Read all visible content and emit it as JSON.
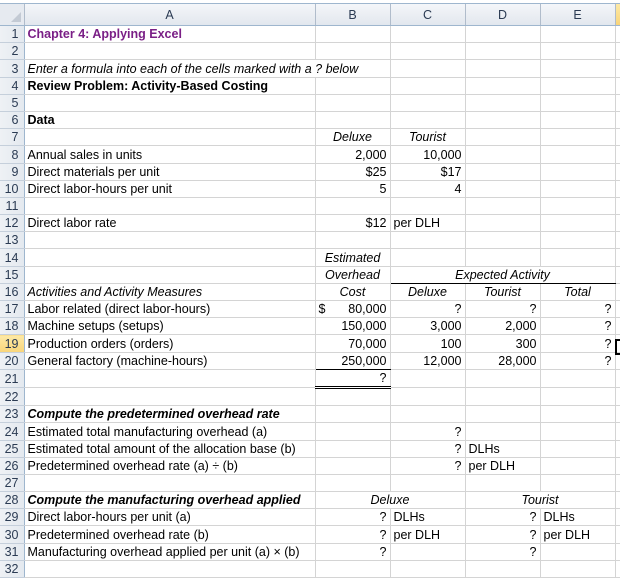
{
  "columns": [
    "A",
    "B",
    "C",
    "D",
    "E"
  ],
  "selected_cell": "F19",
  "rows": {
    "r1": {
      "A": "Chapter 4: Applying Excel"
    },
    "r3": {
      "A": "Enter a formula into each of the cells marked with a ? below"
    },
    "r4": {
      "A": "Review Problem: Activity-Based Costing"
    },
    "r6": {
      "A": "Data"
    },
    "r7": {
      "B": "Deluxe",
      "C": "Tourist"
    },
    "r8": {
      "A": "Annual sales in units",
      "B": "2,000",
      "C": "10,000"
    },
    "r9": {
      "A": "Direct materials per unit",
      "B": "$25",
      "C": "$17"
    },
    "r10": {
      "A": "Direct labor-hours per unit",
      "B": "5",
      "C": "4"
    },
    "r12": {
      "A": "Direct labor rate",
      "B": "$12",
      "C": "per DLH"
    },
    "r14": {
      "B": "Estimated"
    },
    "r15": {
      "B": "Overhead",
      "CDE": "Expected Activity"
    },
    "r16": {
      "A": "Activities and Activity Measures",
      "B": "Cost",
      "C": "Deluxe",
      "D": "Tourist",
      "E": "Total"
    },
    "r17": {
      "A": "Labor related (direct labor-hours)",
      "B_sym": "$",
      "B": "80,000",
      "C": "?",
      "D": "?",
      "E": "?"
    },
    "r18": {
      "A": "Machine setups (setups)",
      "B": "150,000",
      "C": "3,000",
      "D": "2,000",
      "E": "?"
    },
    "r19": {
      "A": "Production orders (orders)",
      "B": "70,000",
      "C": "100",
      "D": "300",
      "E": "?"
    },
    "r20": {
      "A": "General factory (machine-hours)",
      "B": "250,000",
      "C": "12,000",
      "D": "28,000",
      "E": "?"
    },
    "r21": {
      "B": "?"
    },
    "r23": {
      "A": "Compute the predetermined overhead rate"
    },
    "r24": {
      "A": "Estimated total manufacturing overhead (a)",
      "C": "?"
    },
    "r25": {
      "A": "Estimated total amount of the allocation base (b)",
      "C": "?",
      "D": "DLHs"
    },
    "r26": {
      "A": "Predetermined overhead rate (a) ÷ (b)",
      "C": "?",
      "D": "per DLH"
    },
    "r28": {
      "A": "Compute the manufacturing overhead applied",
      "BC": "Deluxe",
      "DE": "Tourist"
    },
    "r29": {
      "A": "Direct labor-hours per unit (a)",
      "B": "?",
      "C": "DLHs",
      "D": "?",
      "E": "DLHs"
    },
    "r30": {
      "A": "Predetermined overhead rate (b)",
      "B": "?",
      "C": "per DLH",
      "D": "?",
      "E": "per DLH"
    },
    "r31": {
      "A": "Manufacturing overhead applied per unit (a) × (b)",
      "B": "?",
      "D": "?"
    }
  },
  "row_numbers": [
    "1",
    "2",
    "3",
    "4",
    "5",
    "6",
    "7",
    "8",
    "9",
    "10",
    "11",
    "12",
    "13",
    "14",
    "15",
    "16",
    "17",
    "18",
    "19",
    "20",
    "21",
    "22",
    "23",
    "24",
    "25",
    "26",
    "27",
    "28",
    "29",
    "30",
    "31",
    "32"
  ]
}
